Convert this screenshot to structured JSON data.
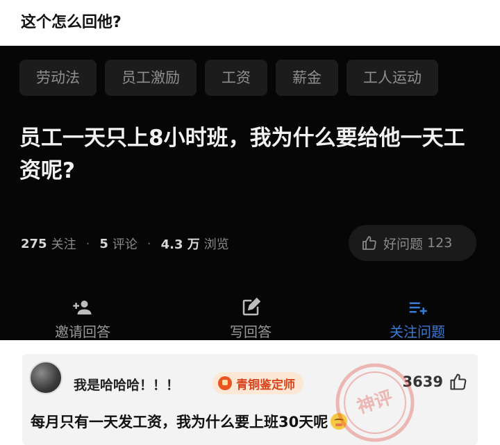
{
  "post": {
    "title": "这个怎么回他?"
  },
  "question_screen": {
    "tags": [
      "劳动法",
      "员工激励",
      "工资",
      "薪金",
      "工人运动"
    ],
    "question": "员工一天只上8小时班，我为什么要给他一天工资呢?",
    "stats": {
      "follow_count": "275",
      "follow_label": "关注",
      "comment_count": "5",
      "comment_label": "评论",
      "view_count": "4.3 万",
      "view_label": "浏览",
      "separator": "·"
    },
    "good_question": {
      "label": "好问题",
      "count": "123"
    },
    "actions": [
      {
        "label": "邀请回答",
        "icon": "person-add-icon"
      },
      {
        "label": "写回答",
        "icon": "edit-icon"
      },
      {
        "label": "关注问题",
        "icon": "playlist-add-icon"
      }
    ]
  },
  "comment": {
    "username": "我是哈哈哈！！！",
    "badge": "青铜鉴定师",
    "likes": "3639",
    "text": "每月只有一天发工资，我为什么要上班30天呢",
    "stamp_text": "神评"
  },
  "colors": {
    "dark_bg": "#060606",
    "accent_blue": "#3a7bd5",
    "badge_orange": "#d8431c",
    "stamp_red": "#e0392b"
  }
}
